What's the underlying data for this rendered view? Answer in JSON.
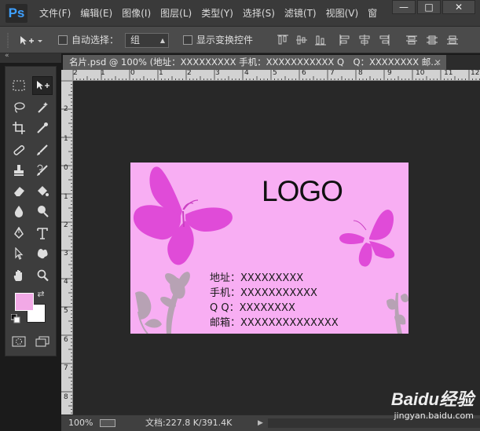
{
  "app": {
    "logo": "Ps",
    "menu": [
      "文件(F)",
      "编辑(E)",
      "图像(I)",
      "图层(L)",
      "类型(Y)",
      "选择(S)",
      "滤镜(T)",
      "视图(V)",
      "窗"
    ],
    "window_buttons": [
      "—",
      "□",
      "✕"
    ]
  },
  "options": {
    "auto_select_label": "自动选择：",
    "auto_select_value": "组",
    "show_transform_label": "显示变换控件"
  },
  "document": {
    "tab_title": "名片.psd @ 100% (地址：XXXXXXXXX 手机：XXXXXXXXXXX Q　Q：XXXXXXXX 邮...",
    "tab_close": "×"
  },
  "rulers": {
    "horizontal": [
      "2",
      "1",
      "0",
      "1",
      "2",
      "3",
      "4",
      "5",
      "6",
      "7",
      "8",
      "9",
      "10",
      "11",
      "12",
      "13"
    ],
    "vertical": [
      "2",
      "1",
      "0",
      "1",
      "2",
      "3",
      "4",
      "5",
      "6",
      "7",
      "8"
    ]
  },
  "card": {
    "logo_text": "LOGO",
    "lines": [
      "地址：XXXXXXXXX",
      "手机：XXXXXXXXXXX",
      "Q  Q：XXXXXXXX",
      "邮箱：XXXXXXXXXXXXXX"
    ],
    "background_color": "#f8aef3",
    "butterfly_color": "#e04bd8",
    "flower_color": "#b7a2b4"
  },
  "colors": {
    "foreground": "#f2a9e6",
    "background": "#ffffff"
  },
  "status": {
    "zoom": "100%",
    "doc_size": "文档:227.8 K/391.4K",
    "arrow": "▶"
  },
  "watermark": {
    "brand": "Baidu经验",
    "url": "jingyan.baidu.com"
  }
}
